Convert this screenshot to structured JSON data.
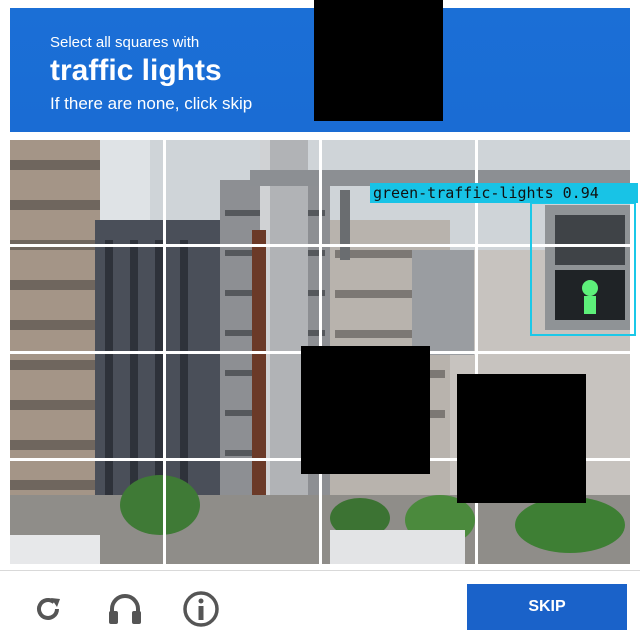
{
  "header": {
    "instruction": "Select all squares with",
    "target": "traffic lights",
    "subtext": "If there are none, click skip"
  },
  "detection": {
    "label": "green-traffic-lights 0.94",
    "color": "#1bc8e8"
  },
  "grid": {
    "rows": 4,
    "cols": 4
  },
  "footer": {
    "reload_icon": "reload-icon",
    "audio_icon": "headphones-icon",
    "info_icon": "info-icon",
    "skip_label": "SKIP"
  },
  "colors": {
    "header_blue": "#1a6cd4",
    "button_blue": "#1a62c9"
  }
}
